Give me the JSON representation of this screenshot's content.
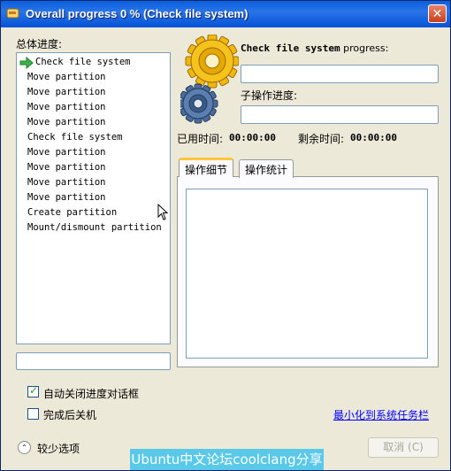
{
  "window": {
    "title": "Overall progress 0 % (Check file system)",
    "close_label": "✕"
  },
  "overall": {
    "label": "总体进度:",
    "items": [
      "Check file system",
      "Move partition",
      "Move partition",
      "Move partition",
      "Move partition",
      "Check file system",
      "Move partition",
      "Move partition",
      "Move partition",
      "Move partition",
      "Create partition",
      "Mount/dismount partition"
    ],
    "current_index": 0
  },
  "op": {
    "name": "Check file system",
    "progress_suffix": " progress:",
    "sub_label": "子操作进度:",
    "elapsed_label": "已用时间:",
    "elapsed_value": "00:00:00",
    "remaining_label": "剩余时间:",
    "remaining_value": "00:00:00"
  },
  "tabs": [
    "操作细节",
    "操作统计"
  ],
  "options": {
    "auto_close_label": "自动关闭进度对话框",
    "auto_close_checked": true,
    "shutdown_label": "完成后关机",
    "shutdown_checked": false
  },
  "minimize_link": "最小化到系统任务栏",
  "fewer_options": "较少选项",
  "cancel_label": "取消 (C)",
  "watermark": "Ubuntu中文论坛coolclang分享",
  "colors": {
    "title_bar": "#0a5fdc",
    "link": "#0000ff",
    "watermark_bg": "#5ac8e8",
    "gear_gold": "#f2b70f",
    "gear_steel": "#4a6c9c"
  }
}
